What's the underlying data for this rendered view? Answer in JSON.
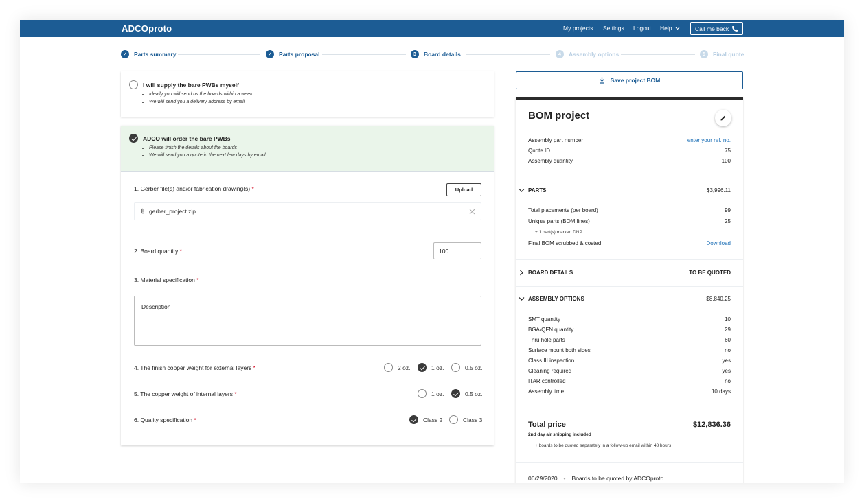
{
  "topbar": {
    "logo": "ADCOproto",
    "nav": [
      "My projects",
      "Settings",
      "Logout",
      "Help"
    ],
    "call_label": "Call me back"
  },
  "steps": [
    {
      "label": "Parts summary",
      "state": "done"
    },
    {
      "label": "Parts proposal",
      "state": "done"
    },
    {
      "label": "Board details",
      "state": "current",
      "number": "3"
    },
    {
      "label": "Assembly options",
      "state": "todo",
      "number": "4"
    },
    {
      "label": "Final quote",
      "state": "todo",
      "number": "5"
    }
  ],
  "supply_options": {
    "self": {
      "title": "I will supply the bare PWBs myself",
      "bullets": [
        "Ideally you will send us the boards within a week",
        "We will send you a delivery address by email"
      ]
    },
    "adco": {
      "title": "ADCO will order the bare PWBs",
      "bullets": [
        "Please finish the details about the boards",
        "We will send you a quote in the next few days by email"
      ]
    }
  },
  "form": {
    "gerber_label": "1. Gerber file(s) and/or fabrication drawing(s)",
    "upload_label": "Upload",
    "file_name": "gerber_project.zip",
    "quantity_label": "2. Board quantity",
    "quantity_value": "100",
    "material_label": "3. Material specification",
    "description_placeholder": "Description",
    "copper_ext_label": "4. The finish copper weight for external layers",
    "copper_ext_options": [
      "2 oz.",
      "1 oz.",
      "0.5 oz."
    ],
    "copper_ext_selected": "1 oz.",
    "copper_int_label": "5. The copper weight of internal layers",
    "copper_int_options": [
      "1 oz.",
      "0.5 oz."
    ],
    "copper_int_selected": "0.5 oz.",
    "quality_label": "6. Quality specification",
    "quality_options": [
      "Class 2",
      "Class 3"
    ],
    "quality_selected": "Class 2",
    "required_mark": "*"
  },
  "bom": {
    "save_label": "Save project BOM",
    "title": "BOM project",
    "header_rows": [
      {
        "label": "Assembly part number",
        "value": "enter your ref. no."
      },
      {
        "label": "Quote ID",
        "value": "75"
      },
      {
        "label": "Assembly quantity",
        "value": "100"
      }
    ],
    "parts": {
      "title": "PARTS",
      "total": "$3,996.11",
      "total_placements_label": "Total placements (per board)",
      "total_placements": "99",
      "unique_parts_label": "Unique parts (BOM lines)",
      "unique_parts": "25",
      "dnp_note": "+ 1 part(s) marked DNP",
      "final_bom_label": "Final BOM scrubbed & costed",
      "download_label": "Download"
    },
    "board_details": {
      "title": "BOARD DETAILS",
      "value": "TO BE QUOTED"
    },
    "assembly_options": {
      "title": "ASSEMBLY OPTIONS",
      "total": "$8,840.25",
      "rows": [
        {
          "label": "SMT quantity",
          "value": "10"
        },
        {
          "label": "BGA/QFN quantity",
          "value": "29"
        },
        {
          "label": "Thru hole parts",
          "value": "60"
        },
        {
          "label": "Surface mount both sides",
          "value": "no"
        },
        {
          "label": "Class III inspection",
          "value": "yes"
        },
        {
          "label": "Cleaning required",
          "value": "yes"
        },
        {
          "label": "ITAR controlled",
          "value": "no"
        },
        {
          "label": "Assembly time",
          "value": "10 days"
        }
      ]
    },
    "total": {
      "label": "Total price",
      "value": "$12,836.36",
      "shipping": "2nd day air shipping included",
      "note": "+ boards to be quoted separately in a follow-up email within 48 hours"
    },
    "footer": {
      "date": "06/29/2020",
      "separator": "•",
      "text": "Boards to be quoted by ADCOproto"
    }
  },
  "colors": {
    "brand": "#1c5c94",
    "selected_bg": "#eaf5ea",
    "link": "#1c6fb6"
  }
}
